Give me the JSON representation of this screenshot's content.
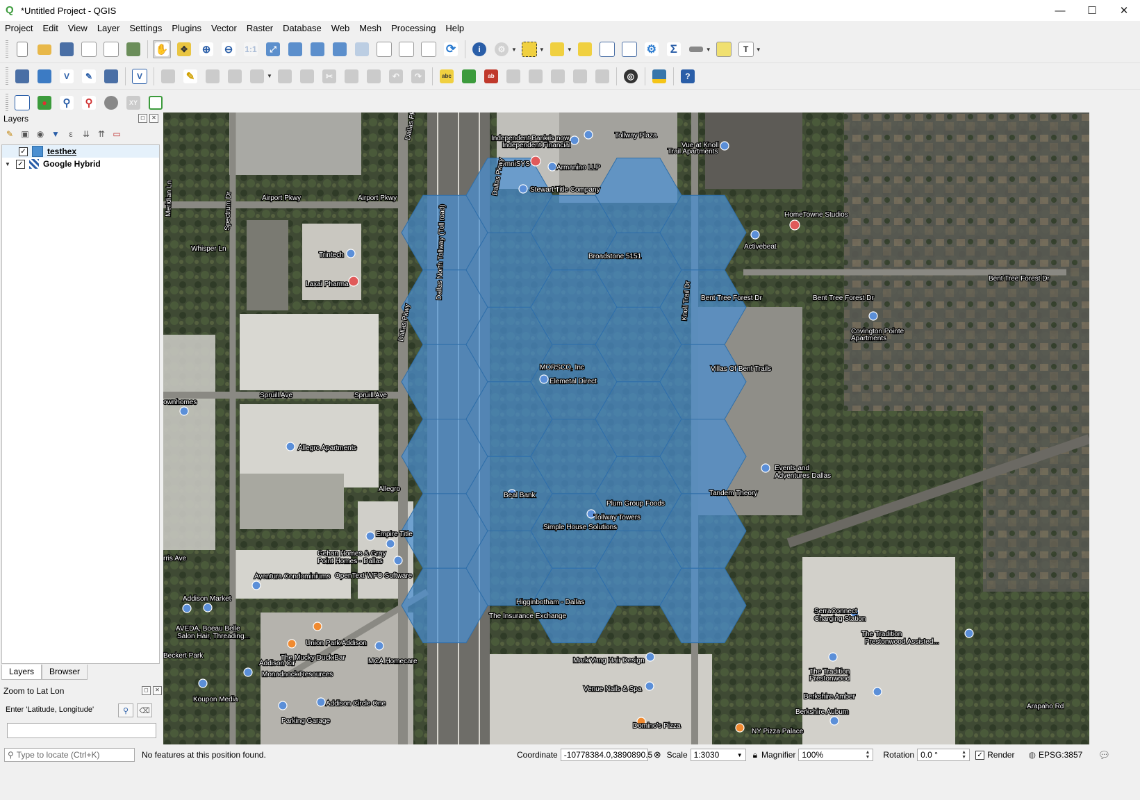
{
  "window": {
    "title": "*Untitled Project - QGIS",
    "minimize": "—",
    "maximize": "☐",
    "close": "✕"
  },
  "menu": [
    "Project",
    "Edit",
    "View",
    "Layer",
    "Settings",
    "Plugins",
    "Vector",
    "Raster",
    "Database",
    "Web",
    "Mesh",
    "Processing",
    "Help"
  ],
  "layers_panel": {
    "title": "Layers",
    "layers": [
      {
        "name": "testhex",
        "checked": true,
        "bold": true,
        "selected": true
      },
      {
        "name": "Google Hybrid",
        "checked": true,
        "bold": false,
        "selected": false
      }
    ],
    "tabs": [
      "Layers",
      "Browser"
    ]
  },
  "zoom_panel": {
    "title": "Zoom to Lat Lon",
    "label": "Enter 'Latitude, Longitude'",
    "value": ""
  },
  "map": {
    "hex_fill": "#4a8fd1",
    "hex_stroke": "#2f6ea8",
    "labels": [
      "Independent Bank is now",
      "Independent Financial",
      "Tollway Plaza",
      "OmniSYS",
      "Armanino LLP",
      "Stewart Title Company",
      "Vue at Knoll",
      "Trail Apartments",
      "HomeTowne Studios",
      "Activebeat",
      "Broadstone 5151",
      "Airport Pkwy",
      "Airport Pkwy",
      "Whisper Ln",
      "Trintech",
      "Laxai Pharma",
      "Bent Tree Forest Dr",
      "Bent Tree Forest Dr",
      "Bent Tree Forest Dr",
      "Covington Pointe",
      "Apartments",
      "MORSCO, Inc",
      "Elemetal Direct",
      "Villas Of Bent Trails",
      "Spruill Ave",
      "Spruill Ave",
      "ownhomes",
      "Allegro Apartments",
      "Events and",
      "Adventures Dallas",
      "Beal Bank",
      "Plum Group Foods",
      "Tandem Theory",
      "Tollway Towers",
      "Simple House Solutions",
      "Empire Title",
      "Gehan Homes & Gray",
      "Point Homes - Dallas",
      "OpenText WFO Software",
      "rris Ave",
      "Aventura Condominiums",
      "Addison Market",
      "AVEDA, Boeau Belle",
      "Salon Hair, Threading...",
      "Higginbotham - Dallas",
      "The Insurance Exchange",
      "SerraConnect",
      "Charging Station",
      "The Tradition",
      "Prestonwood Assisted...",
      "Union Park Addison",
      "The Mucky Duck Bar",
      "MCA Homecare",
      "Beckert Park",
      "Mark Vang Hair Design",
      "Monadnock Resources",
      "Koupon Media",
      "Venue Nails & Spa",
      "The Tradition",
      "Prestonwood",
      "Berkshire Amber",
      "Berkshire Auburn",
      "Arapaho Rd",
      "Addison Circle One",
      "Parking Garage",
      "Domino's Pizza",
      "NY Pizza Palace",
      "Dallas Pkwy",
      "Dallas Pkwy",
      "Dallas Pkwy",
      "Dallas North Tollway (Toll road)",
      "Knoll Trail Dr",
      "Spectrum Dr",
      "Meridian Ln",
      "Addison Cir",
      "Allegro"
    ]
  },
  "status": {
    "locate_placeholder": "Type to locate (Ctrl+K)",
    "message": "No features at this position found.",
    "coordinate_label": "Coordinate",
    "coordinate": "-10778384.0,3890890.5",
    "scale_label": "Scale",
    "scale": "1:3030",
    "magnifier_label": "Magnifier",
    "magnifier": "100%",
    "rotation_label": "Rotation",
    "rotation": "0.0 °",
    "render_label": "Render",
    "crs": "EPSG:3857"
  }
}
